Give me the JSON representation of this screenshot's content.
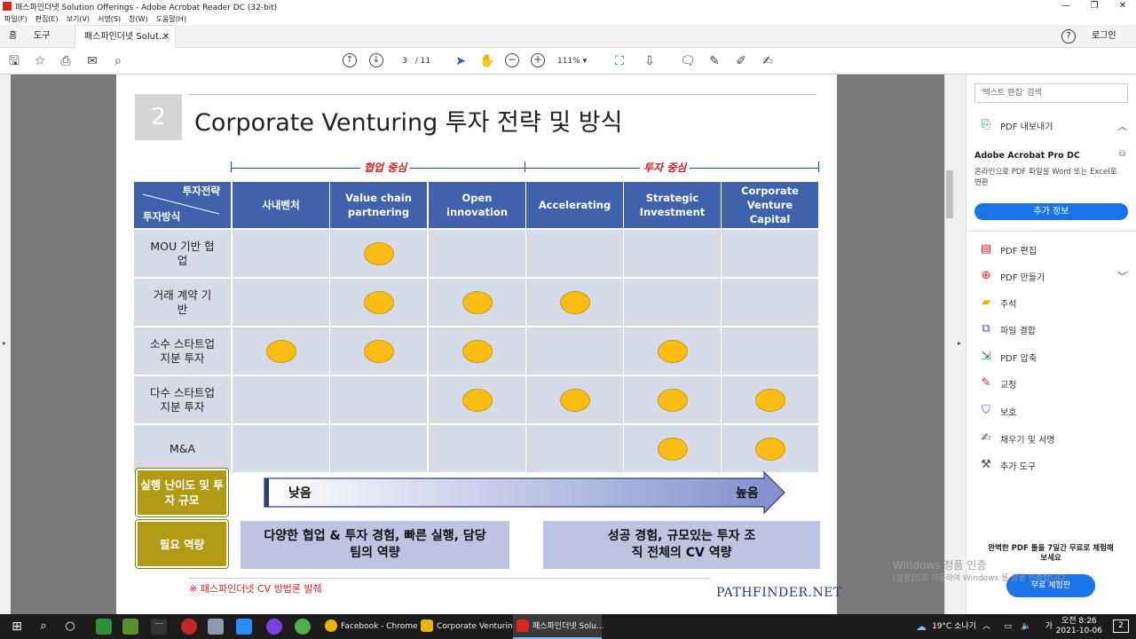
{
  "window": {
    "title": "패스파인더넷 Solution Offerings - Adobe Acrobat Reader DC (32-bit)"
  },
  "menu": [
    "파일(F)",
    "편집(E)",
    "보기(V)",
    "서명(S)",
    "창(W)",
    "도움말(H)"
  ],
  "tabs": {
    "home": "홈",
    "tools": "도구",
    "doc": "패스파인더넷 Solut...",
    "login": "로그인"
  },
  "toolbar": {
    "page_current": "3",
    "page_total": "/ 11",
    "zoom": "111%"
  },
  "slide": {
    "section_number": "2",
    "title": "Corporate Venturing 투자 전략 및 방식",
    "arrow_left_label": "협업 중심",
    "arrow_right_label": "투자 중심",
    "corner_top": "투자전략",
    "corner_bottom": "투자방식",
    "columns": [
      "사내벤처",
      "Value chain partnering",
      "Open innovation",
      "Accelerating",
      "Strategic Investment",
      "Corporate Venture Capital"
    ],
    "rows": [
      {
        "label": "MOU 기반 협업",
        "marks": [
          false,
          true,
          false,
          false,
          false,
          false
        ]
      },
      {
        "label": "거래 계약 기반",
        "marks": [
          false,
          true,
          true,
          true,
          false,
          false
        ]
      },
      {
        "label": "소수 스타트업 지분 투자",
        "marks": [
          true,
          true,
          true,
          false,
          true,
          false
        ]
      },
      {
        "label": "다수 스타트업 지분 투자",
        "marks": [
          false,
          false,
          true,
          true,
          true,
          true
        ]
      },
      {
        "label": "M&A",
        "marks": [
          false,
          false,
          false,
          false,
          true,
          true
        ]
      }
    ],
    "difficulty_label": "실행 난이도 및 투자 규모",
    "difficulty_low": "낮음",
    "difficulty_high": "높음",
    "capability_label": "필요 역량",
    "capability_left": "다양한 협업 & 투자 경험, 빠른 실행, 담당 팀의 역량",
    "capability_right": "성공 경험, 규모있는 투자 조직 전체의 CV 역량",
    "footnote": "※ 패스파인더넷 CV 방법론 발췌",
    "brand": "PATHFINDER.NET"
  },
  "sidebar": {
    "search_placeholder": "'텍스트 편집' 검색",
    "export_label": "PDF 내보내기",
    "promo_title": "Adobe Acrobat Pro DC",
    "promo_desc": "온라인으로 PDF 파일을 Word 또는 Excel로 변환",
    "promo_button": "추가 정보",
    "items": [
      "PDF 편집",
      "PDF 만들기",
      "주석",
      "파일 결합",
      "PDF 압축",
      "교정",
      "보호",
      "채우기 및 서명",
      "추가 도구"
    ],
    "trial_text": "완벽한 PDF 툴을 7일간 무료로 체험해 보세요",
    "trial_button": "무료 체험판"
  },
  "watermark": {
    "line1": "Windows 정품 인증",
    "line2": "[설정]으로 이동하여 Windows 를 정품 인증합니다."
  },
  "taskbar": {
    "tasks": [
      "Facebook - Chrome",
      "Corporate Venturin...",
      "패스파인더넷 Solu..."
    ],
    "weather": "19°C 소나기",
    "time": "오전 8:26",
    "date": "2021-10-06",
    "notifications": "2"
  },
  "colors": {
    "header_blue": "#4062ad",
    "cell_gray": "#d6dbe8",
    "dot_yellow": "#fbbd14",
    "gold_box": "#b19a14",
    "accent_red": "#d8232a"
  }
}
